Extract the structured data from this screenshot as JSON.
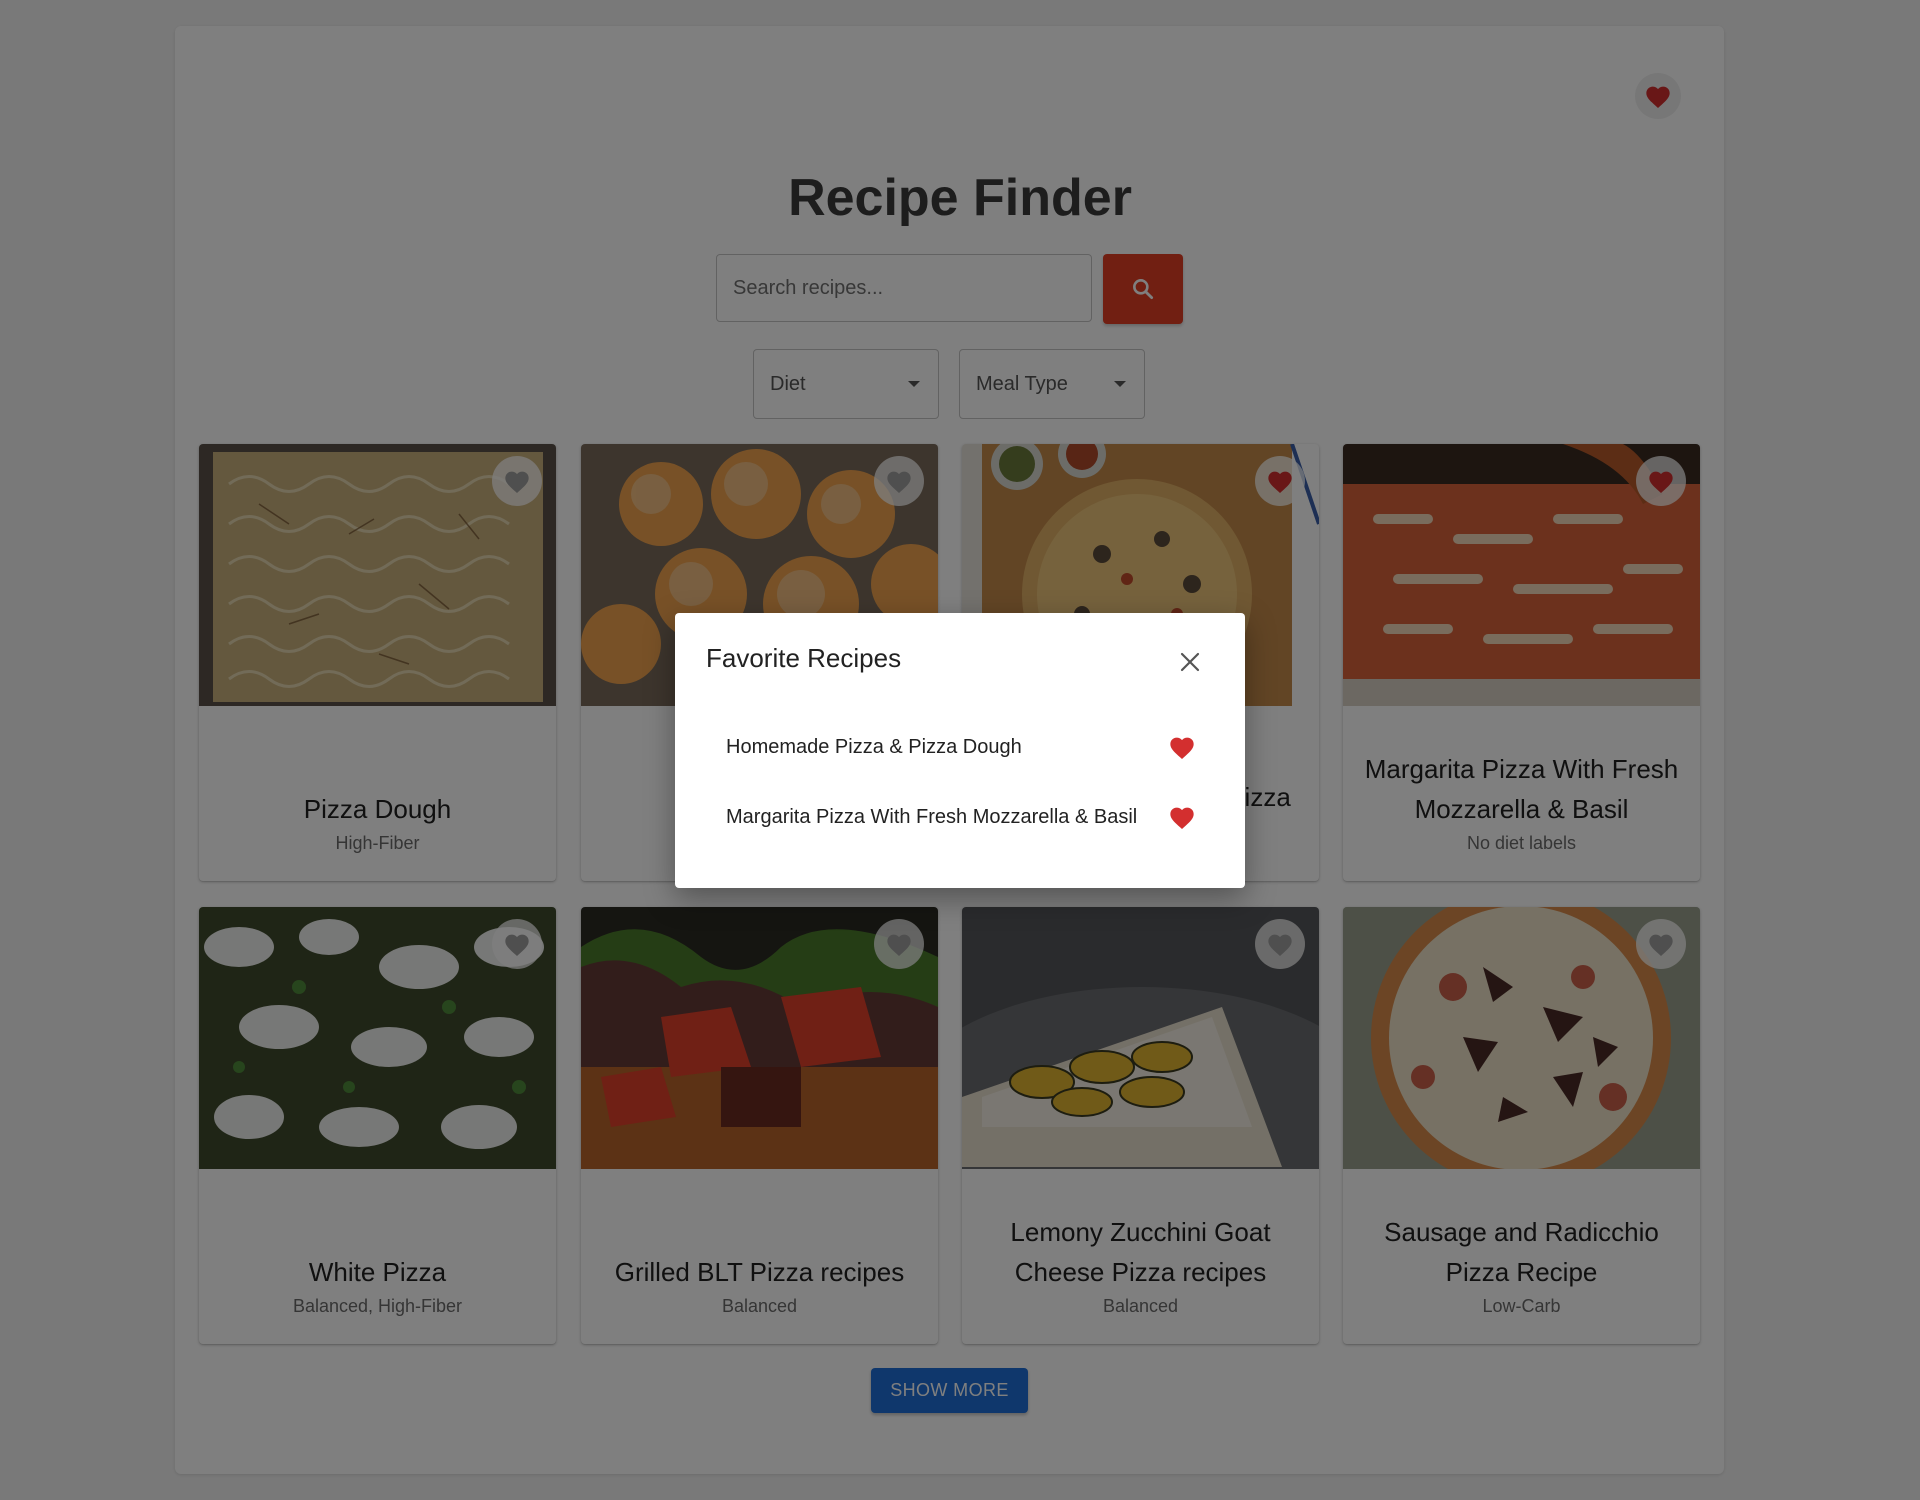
{
  "app": {
    "title": "Recipe Finder"
  },
  "search": {
    "placeholder": "Search recipes..."
  },
  "filters": [
    {
      "label": "Diet"
    },
    {
      "label": "Meal Type"
    }
  ],
  "recipes": [
    {
      "title": "Pizza Dough",
      "labels": "High-Fiber",
      "favorite": false
    },
    {
      "title": "",
      "labels": "",
      "favorite": false
    },
    {
      "title": "Homemade Pizza & Pizza Dough",
      "labels": "",
      "favorite": true
    },
    {
      "title": "Margarita Pizza With Fresh Mozzarella & Basil",
      "labels": "No diet labels",
      "favorite": true
    },
    {
      "title": "White Pizza",
      "labels": "Balanced, High-Fiber",
      "favorite": false
    },
    {
      "title": "Grilled BLT Pizza recipes",
      "labels": "Balanced",
      "favorite": false
    },
    {
      "title": "Lemony Zucchini Goat Cheese Pizza recipes",
      "labels": "Balanced",
      "favorite": false
    },
    {
      "title": "Sausage and Radicchio Pizza Recipe",
      "labels": "Low-Carb",
      "favorite": false
    }
  ],
  "show_more_label": "SHOW MORE",
  "favorites_modal": {
    "title": "Favorite Recipes",
    "items": [
      {
        "label": "Homemade Pizza & Pizza Dough"
      },
      {
        "label": "Margarita Pizza With Fresh Mozzarella & Basil"
      }
    ]
  },
  "colors": {
    "accent_red": "#e23e25",
    "favorite_heart": "#d32f2f",
    "primary_blue": "#1e6fd9",
    "heart_inactive": "#9e9e9e"
  }
}
